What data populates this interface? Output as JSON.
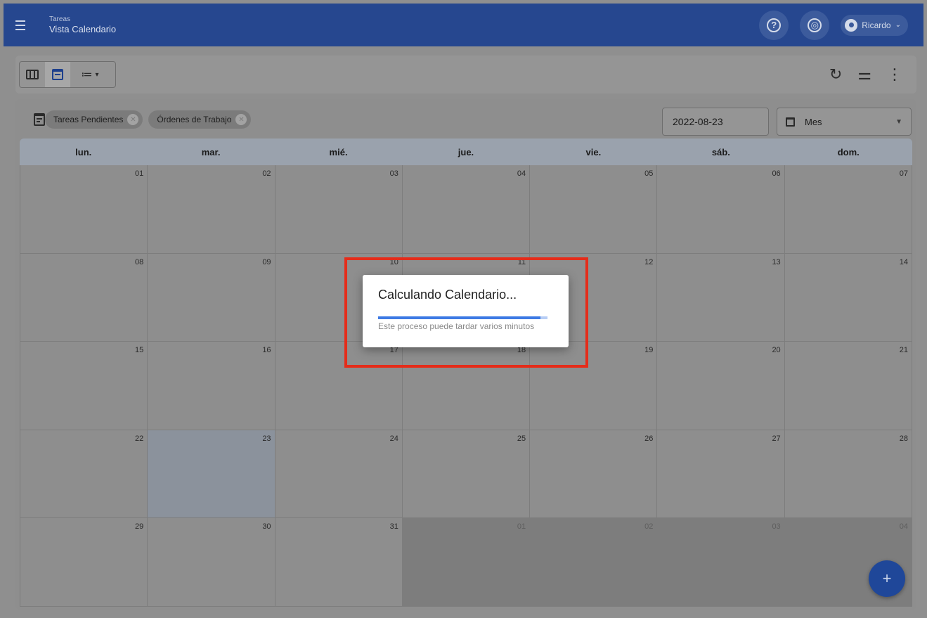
{
  "header": {
    "section": "Tareas",
    "title": "Vista Calendario",
    "user_name": "Ricardo"
  },
  "toolbar": {
    "list_chevron": "▾",
    "refresh_icon": "↻",
    "filter_icon": "⚌",
    "more_icon": "⋮"
  },
  "filters": {
    "chips": [
      {
        "label": "Tareas Pendientes"
      },
      {
        "label": "Órdenes de Trabajo"
      }
    ],
    "date_value": "2022-08-23",
    "view_mode": "Mes"
  },
  "calendar": {
    "weekdays": [
      "lun.",
      "mar.",
      "mié.",
      "jue.",
      "vie.",
      "sáb.",
      "dom."
    ],
    "weeks": [
      [
        "01",
        "02",
        "03",
        "04",
        "05",
        "06",
        "07"
      ],
      [
        "08",
        "09",
        "10",
        "11",
        "12",
        "13",
        "14"
      ],
      [
        "15",
        "16",
        "17",
        "18",
        "19",
        "20",
        "21"
      ],
      [
        "22",
        "23",
        "24",
        "25",
        "26",
        "27",
        "28"
      ],
      [
        "29",
        "30",
        "31",
        "01",
        "02",
        "03",
        "04"
      ]
    ],
    "selected_day": "23"
  },
  "dialog": {
    "title": "Calculando Calendario...",
    "message": "Este proceso puede tardar varios minutos",
    "progress": 0.96
  },
  "fab": {
    "label": "+"
  }
}
